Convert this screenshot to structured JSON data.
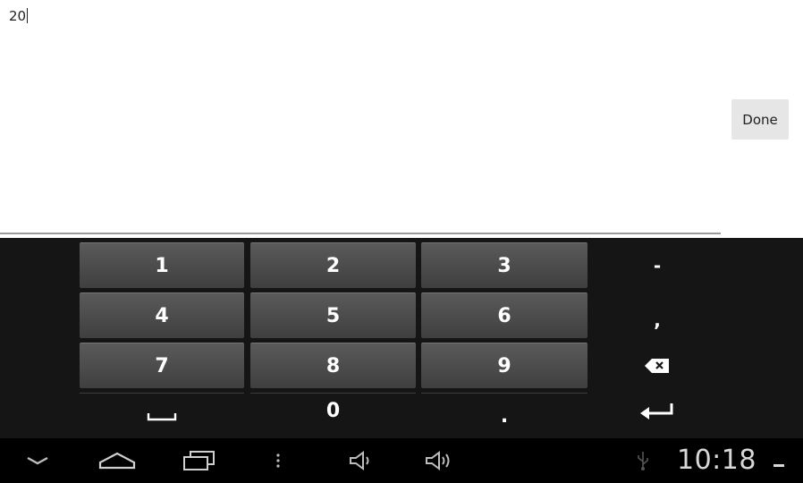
{
  "input": {
    "value": "20"
  },
  "done_button": {
    "label": "Done"
  },
  "keyboard": {
    "rows": [
      [
        "1",
        "2",
        "3"
      ],
      [
        "4",
        "5",
        "6"
      ],
      [
        "7",
        "8",
        "9"
      ]
    ],
    "zero": "0",
    "period": ".",
    "minus": "-",
    "comma": ",",
    "icons": {
      "space": "space-icon",
      "backspace": "backspace-icon",
      "enter": "enter-icon"
    }
  },
  "status_bar": {
    "time": "10:18",
    "icons": [
      "back-down-icon",
      "home-icon",
      "recent-apps-icon",
      "menu-dots-icon",
      "volume-down-icon",
      "volume-up-icon",
      "usb-icon"
    ]
  },
  "colors": {
    "keyboard_bg": "#151515",
    "key_bg": "#4a4a4a",
    "nav_bg": "#000000"
  }
}
